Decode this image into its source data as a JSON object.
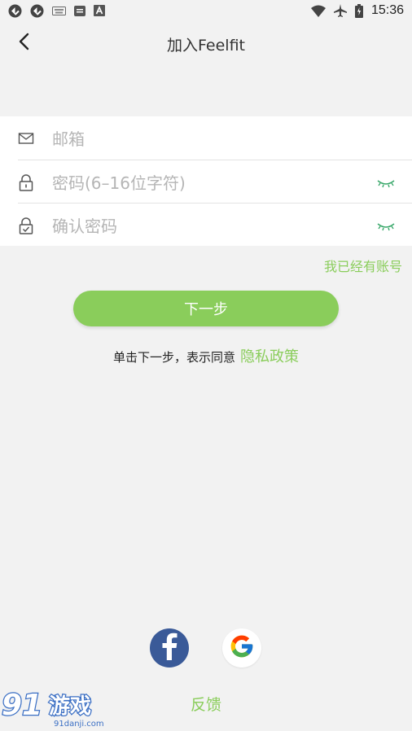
{
  "status_bar": {
    "time": "15:36",
    "left_icons": [
      "sync-icon",
      "sync-icon",
      "keyboard-icon",
      "app-icon",
      "font-icon"
    ],
    "right_icons": [
      "wifi-icon",
      "airplane-icon",
      "battery-icon"
    ]
  },
  "header": {
    "title": "加入Feelfit",
    "back_icon": "back-arrow-icon"
  },
  "form": {
    "email_placeholder": "邮箱",
    "password_placeholder": "密码(6–16位字符)",
    "confirm_placeholder": "确认密码"
  },
  "have_account": "我已经有账号",
  "next_button": "下一步",
  "agree": {
    "text": "单击下一步，表示同意",
    "link": "隐私政策"
  },
  "social": {
    "facebook": "facebook-icon",
    "google": "google-icon"
  },
  "feedback": "反馈",
  "watermark": {
    "brand": "91游戏",
    "site": "91danji.com"
  },
  "colors": {
    "accent": "#8acd5b",
    "background": "#f2f2f2",
    "facebook": "#3a5a98"
  }
}
